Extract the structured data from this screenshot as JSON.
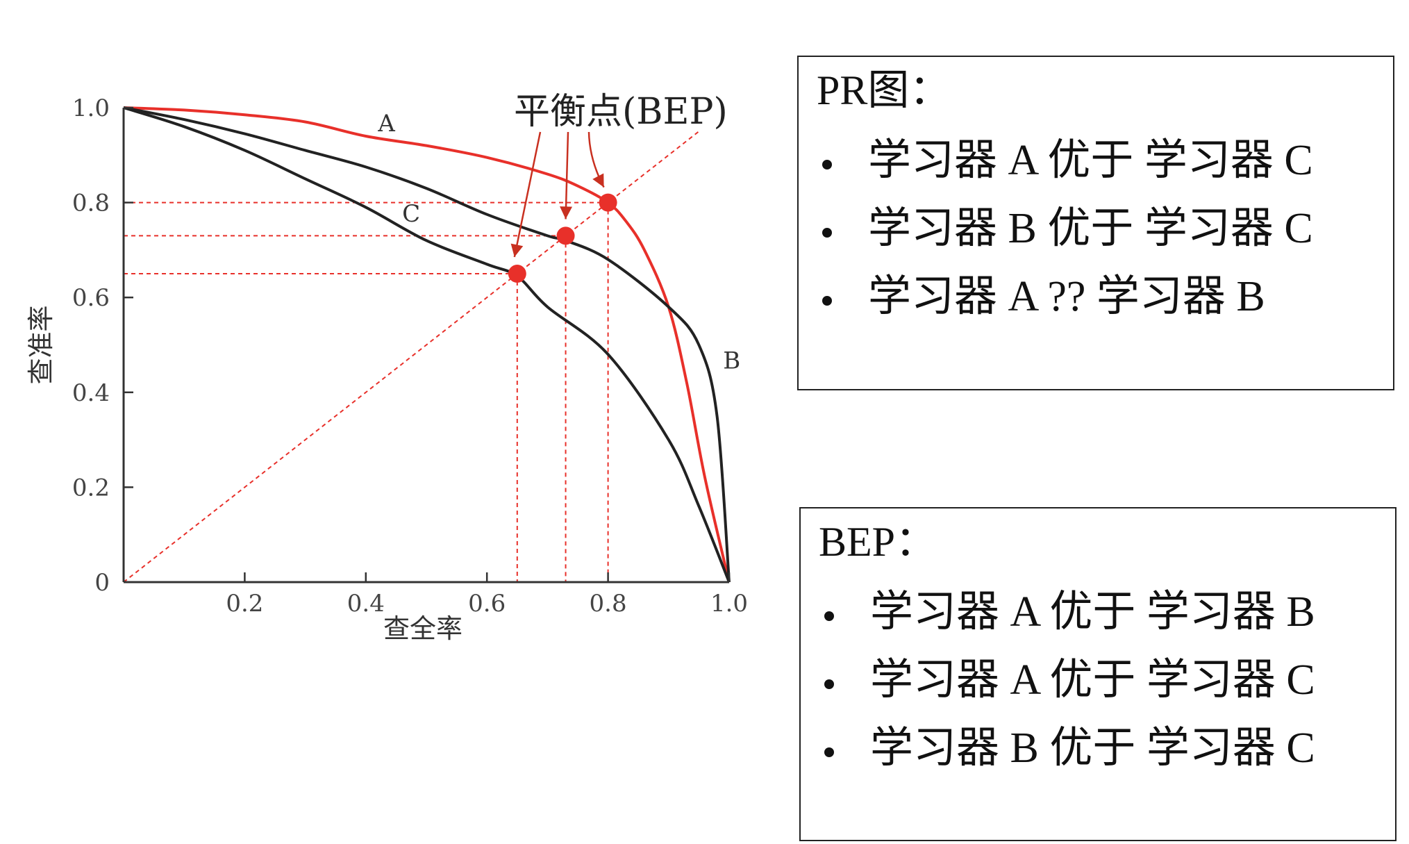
{
  "chart_data": {
    "type": "line",
    "xlabel": "查全率",
    "ylabel": "查准率",
    "xlim": [
      0,
      1.0
    ],
    "ylim": [
      0,
      1.0
    ],
    "x_ticks": [
      "0.2",
      "0.4",
      "0.6",
      "0.8",
      "1.0"
    ],
    "y_ticks": [
      "0",
      "0.2",
      "0.4",
      "0.6",
      "0.8",
      "1.0"
    ],
    "series": [
      {
        "name": "A",
        "color": "#e8302a",
        "x": [
          0,
          0.1,
          0.2,
          0.3,
          0.4,
          0.5,
          0.6,
          0.7,
          0.75,
          0.8,
          0.83,
          0.86,
          0.9,
          0.93,
          0.96,
          1.0
        ],
        "y": [
          1.0,
          0.995,
          0.985,
          0.97,
          0.94,
          0.92,
          0.895,
          0.86,
          0.835,
          0.8,
          0.76,
          0.7,
          0.58,
          0.42,
          0.22,
          0
        ]
      },
      {
        "name": "B",
        "color": "#222222",
        "x": [
          0,
          0.1,
          0.2,
          0.3,
          0.4,
          0.5,
          0.6,
          0.7,
          0.73,
          0.8,
          0.9,
          0.95,
          0.98,
          1.0
        ],
        "y": [
          1.0,
          0.975,
          0.945,
          0.91,
          0.875,
          0.83,
          0.775,
          0.73,
          0.72,
          0.68,
          0.58,
          0.5,
          0.35,
          0
        ]
      },
      {
        "name": "C",
        "color": "#222222",
        "x": [
          0,
          0.1,
          0.2,
          0.3,
          0.4,
          0.5,
          0.6,
          0.65,
          0.7,
          0.8,
          0.9,
          0.95,
          1.0
        ],
        "y": [
          1.0,
          0.96,
          0.91,
          0.85,
          0.79,
          0.72,
          0.67,
          0.645,
          0.58,
          0.48,
          0.3,
          0.16,
          0
        ]
      }
    ],
    "bep_points": [
      {
        "curve": "A",
        "value": 0.8
      },
      {
        "curve": "B",
        "value": 0.73
      },
      {
        "curve": "C",
        "value": 0.65
      }
    ],
    "annotation": "平衡点(BEP)",
    "diagonal": true,
    "grid": false
  },
  "panels": {
    "pr": {
      "title": "PR图：",
      "items": [
        "学习器 A 优于 学习器 C",
        "学习器 B 优于 学习器 C",
        "学习器 A  ?? 学习器 B"
      ]
    },
    "bep": {
      "title": "BEP：",
      "items": [
        "学习器 A 优于 学习器 B",
        "学习器 A 优于 学习器 C",
        "学习器 B 优于 学习器 C"
      ]
    }
  }
}
